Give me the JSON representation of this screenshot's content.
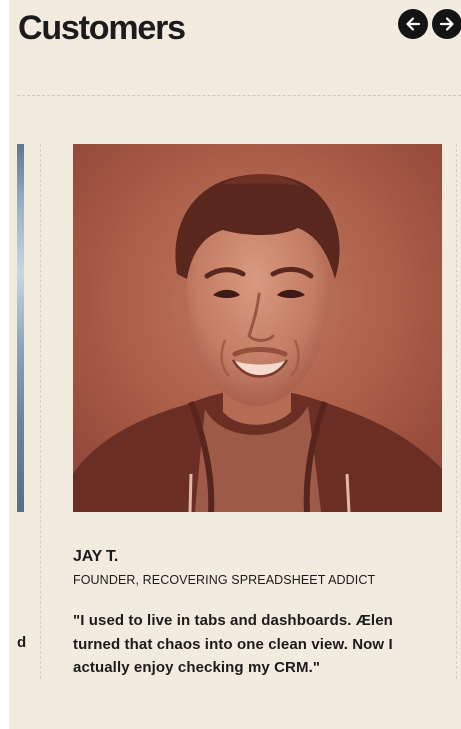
{
  "section": {
    "title": "Customers"
  },
  "carousel": {
    "prev_label": "Previous",
    "next_label": "Next",
    "prev_icon": "arrow-left-icon",
    "next_icon": "arrow-right-icon",
    "peek_text": "d"
  },
  "testimonial": {
    "name": "JAY T.",
    "role": "FOUNDER, RECOVERING SPREADSHEET ADDICT",
    "quote": "\"I used to live in tabs and dashboards. Ælen turned that chaos into one clean view. Now I actually enjoy checking my CRM.\""
  },
  "colors": {
    "background": "#f1ebe0",
    "text": "#1c1c1c",
    "photo_tint": "#a5553f",
    "button": "#141414"
  }
}
